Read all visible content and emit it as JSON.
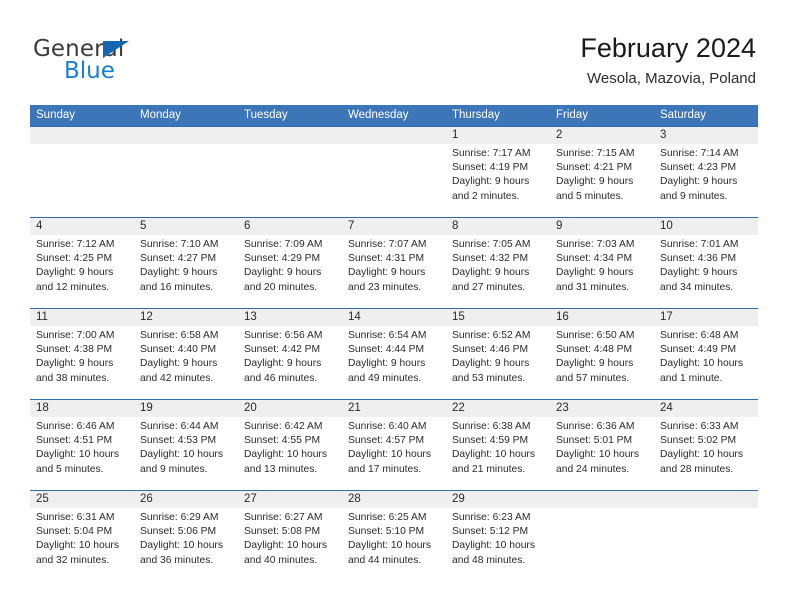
{
  "brand": {
    "name_dark": "General",
    "name_blue": "Blue",
    "triangle_color": "#1565b0",
    "blue_color": "#1a7fd4"
  },
  "header": {
    "title": "February 2024",
    "subtitle": "Wesola, Mazovia, Poland"
  },
  "theme": {
    "header_blue": "#3d76b8",
    "separator_blue": "#2e6cae",
    "band_gray": "#efefef",
    "text": "#2b2b2b"
  },
  "weekdays": [
    "Sunday",
    "Monday",
    "Tuesday",
    "Wednesday",
    "Thursday",
    "Friday",
    "Saturday"
  ],
  "weeks": [
    [
      {
        "day": "",
        "lines": [
          "",
          "",
          "",
          ""
        ]
      },
      {
        "day": "",
        "lines": [
          "",
          "",
          "",
          ""
        ]
      },
      {
        "day": "",
        "lines": [
          "",
          "",
          "",
          ""
        ]
      },
      {
        "day": "",
        "lines": [
          "",
          "",
          "",
          ""
        ]
      },
      {
        "day": "1",
        "lines": [
          "Sunrise: 7:17 AM",
          "Sunset: 4:19 PM",
          "Daylight: 9 hours",
          "and 2 minutes."
        ]
      },
      {
        "day": "2",
        "lines": [
          "Sunrise: 7:15 AM",
          "Sunset: 4:21 PM",
          "Daylight: 9 hours",
          "and 5 minutes."
        ]
      },
      {
        "day": "3",
        "lines": [
          "Sunrise: 7:14 AM",
          "Sunset: 4:23 PM",
          "Daylight: 9 hours",
          "and 9 minutes."
        ]
      }
    ],
    [
      {
        "day": "4",
        "lines": [
          "Sunrise: 7:12 AM",
          "Sunset: 4:25 PM",
          "Daylight: 9 hours",
          "and 12 minutes."
        ]
      },
      {
        "day": "5",
        "lines": [
          "Sunrise: 7:10 AM",
          "Sunset: 4:27 PM",
          "Daylight: 9 hours",
          "and 16 minutes."
        ]
      },
      {
        "day": "6",
        "lines": [
          "Sunrise: 7:09 AM",
          "Sunset: 4:29 PM",
          "Daylight: 9 hours",
          "and 20 minutes."
        ]
      },
      {
        "day": "7",
        "lines": [
          "Sunrise: 7:07 AM",
          "Sunset: 4:31 PM",
          "Daylight: 9 hours",
          "and 23 minutes."
        ]
      },
      {
        "day": "8",
        "lines": [
          "Sunrise: 7:05 AM",
          "Sunset: 4:32 PM",
          "Daylight: 9 hours",
          "and 27 minutes."
        ]
      },
      {
        "day": "9",
        "lines": [
          "Sunrise: 7:03 AM",
          "Sunset: 4:34 PM",
          "Daylight: 9 hours",
          "and 31 minutes."
        ]
      },
      {
        "day": "10",
        "lines": [
          "Sunrise: 7:01 AM",
          "Sunset: 4:36 PM",
          "Daylight: 9 hours",
          "and 34 minutes."
        ]
      }
    ],
    [
      {
        "day": "11",
        "lines": [
          "Sunrise: 7:00 AM",
          "Sunset: 4:38 PM",
          "Daylight: 9 hours",
          "and 38 minutes."
        ]
      },
      {
        "day": "12",
        "lines": [
          "Sunrise: 6:58 AM",
          "Sunset: 4:40 PM",
          "Daylight: 9 hours",
          "and 42 minutes."
        ]
      },
      {
        "day": "13",
        "lines": [
          "Sunrise: 6:56 AM",
          "Sunset: 4:42 PM",
          "Daylight: 9 hours",
          "and 46 minutes."
        ]
      },
      {
        "day": "14",
        "lines": [
          "Sunrise: 6:54 AM",
          "Sunset: 4:44 PM",
          "Daylight: 9 hours",
          "and 49 minutes."
        ]
      },
      {
        "day": "15",
        "lines": [
          "Sunrise: 6:52 AM",
          "Sunset: 4:46 PM",
          "Daylight: 9 hours",
          "and 53 minutes."
        ]
      },
      {
        "day": "16",
        "lines": [
          "Sunrise: 6:50 AM",
          "Sunset: 4:48 PM",
          "Daylight: 9 hours",
          "and 57 minutes."
        ]
      },
      {
        "day": "17",
        "lines": [
          "Sunrise: 6:48 AM",
          "Sunset: 4:49 PM",
          "Daylight: 10 hours",
          "and 1 minute."
        ]
      }
    ],
    [
      {
        "day": "18",
        "lines": [
          "Sunrise: 6:46 AM",
          "Sunset: 4:51 PM",
          "Daylight: 10 hours",
          "and 5 minutes."
        ]
      },
      {
        "day": "19",
        "lines": [
          "Sunrise: 6:44 AM",
          "Sunset: 4:53 PM",
          "Daylight: 10 hours",
          "and 9 minutes."
        ]
      },
      {
        "day": "20",
        "lines": [
          "Sunrise: 6:42 AM",
          "Sunset: 4:55 PM",
          "Daylight: 10 hours",
          "and 13 minutes."
        ]
      },
      {
        "day": "21",
        "lines": [
          "Sunrise: 6:40 AM",
          "Sunset: 4:57 PM",
          "Daylight: 10 hours",
          "and 17 minutes."
        ]
      },
      {
        "day": "22",
        "lines": [
          "Sunrise: 6:38 AM",
          "Sunset: 4:59 PM",
          "Daylight: 10 hours",
          "and 21 minutes."
        ]
      },
      {
        "day": "23",
        "lines": [
          "Sunrise: 6:36 AM",
          "Sunset: 5:01 PM",
          "Daylight: 10 hours",
          "and 24 minutes."
        ]
      },
      {
        "day": "24",
        "lines": [
          "Sunrise: 6:33 AM",
          "Sunset: 5:02 PM",
          "Daylight: 10 hours",
          "and 28 minutes."
        ]
      }
    ],
    [
      {
        "day": "25",
        "lines": [
          "Sunrise: 6:31 AM",
          "Sunset: 5:04 PM",
          "Daylight: 10 hours",
          "and 32 minutes."
        ]
      },
      {
        "day": "26",
        "lines": [
          "Sunrise: 6:29 AM",
          "Sunset: 5:06 PM",
          "Daylight: 10 hours",
          "and 36 minutes."
        ]
      },
      {
        "day": "27",
        "lines": [
          "Sunrise: 6:27 AM",
          "Sunset: 5:08 PM",
          "Daylight: 10 hours",
          "and 40 minutes."
        ]
      },
      {
        "day": "28",
        "lines": [
          "Sunrise: 6:25 AM",
          "Sunset: 5:10 PM",
          "Daylight: 10 hours",
          "and 44 minutes."
        ]
      },
      {
        "day": "29",
        "lines": [
          "Sunrise: 6:23 AM",
          "Sunset: 5:12 PM",
          "Daylight: 10 hours",
          "and 48 minutes."
        ]
      },
      {
        "day": "",
        "lines": [
          "",
          "",
          "",
          ""
        ]
      },
      {
        "day": "",
        "lines": [
          "",
          "",
          "",
          ""
        ]
      }
    ]
  ]
}
